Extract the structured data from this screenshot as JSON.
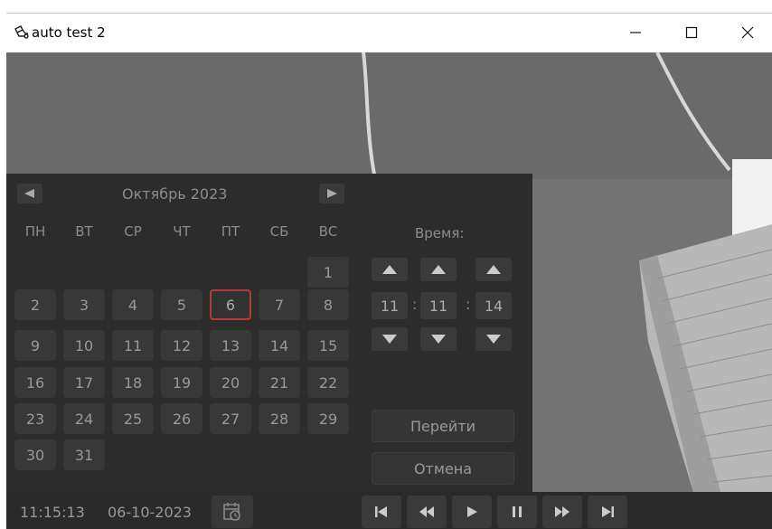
{
  "window": {
    "title": "auto test 2"
  },
  "calendar": {
    "month_title": "Октябрь 2023",
    "weekdays": [
      "ПН",
      "ВТ",
      "СР",
      "ЧТ",
      "ПТ",
      "СБ",
      "ВС"
    ],
    "days": [
      "1",
      "2",
      "3",
      "4",
      "5",
      "6",
      "7",
      "8",
      "9",
      "10",
      "11",
      "12",
      "13",
      "14",
      "15",
      "16",
      "17",
      "18",
      "19",
      "20",
      "21",
      "22",
      "23",
      "24",
      "25",
      "26",
      "27",
      "28",
      "29",
      "30",
      "31"
    ],
    "selected_day": "6",
    "accent_color": "#b53a3a"
  },
  "time": {
    "label": "Время:",
    "hours": "11",
    "minutes": "11",
    "seconds": "14",
    "separator": ":"
  },
  "actions": {
    "go_label": "Перейти",
    "cancel_label": "Отмена"
  },
  "status": {
    "time": "11:15:13",
    "date": "06-10-2023"
  }
}
